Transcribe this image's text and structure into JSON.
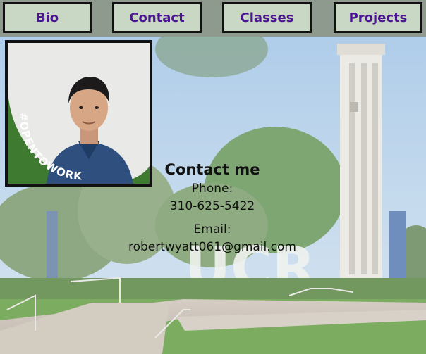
{
  "nav": {
    "items": [
      {
        "id": "bio",
        "label": "Bio"
      },
      {
        "id": "contact",
        "label": "Contact"
      },
      {
        "id": "classes",
        "label": "Classes"
      },
      {
        "id": "projects",
        "label": "Projects"
      }
    ]
  },
  "profile": {
    "badge_text": "#OPENTOWORK"
  },
  "background": {
    "sign_text": "UCR"
  },
  "contact": {
    "heading": "Contact me",
    "phone_label": "Phone:",
    "phone_value": "310-625-5422",
    "email_label": "Email:",
    "email_value": "robertwyatt061@gmail.com"
  },
  "colors": {
    "nav_text": "#4b1591",
    "nav_button_bg": "#c9d8c5",
    "nav_bar_bg": "#8d9a8d",
    "badge_green": "#3e7a2f"
  }
}
